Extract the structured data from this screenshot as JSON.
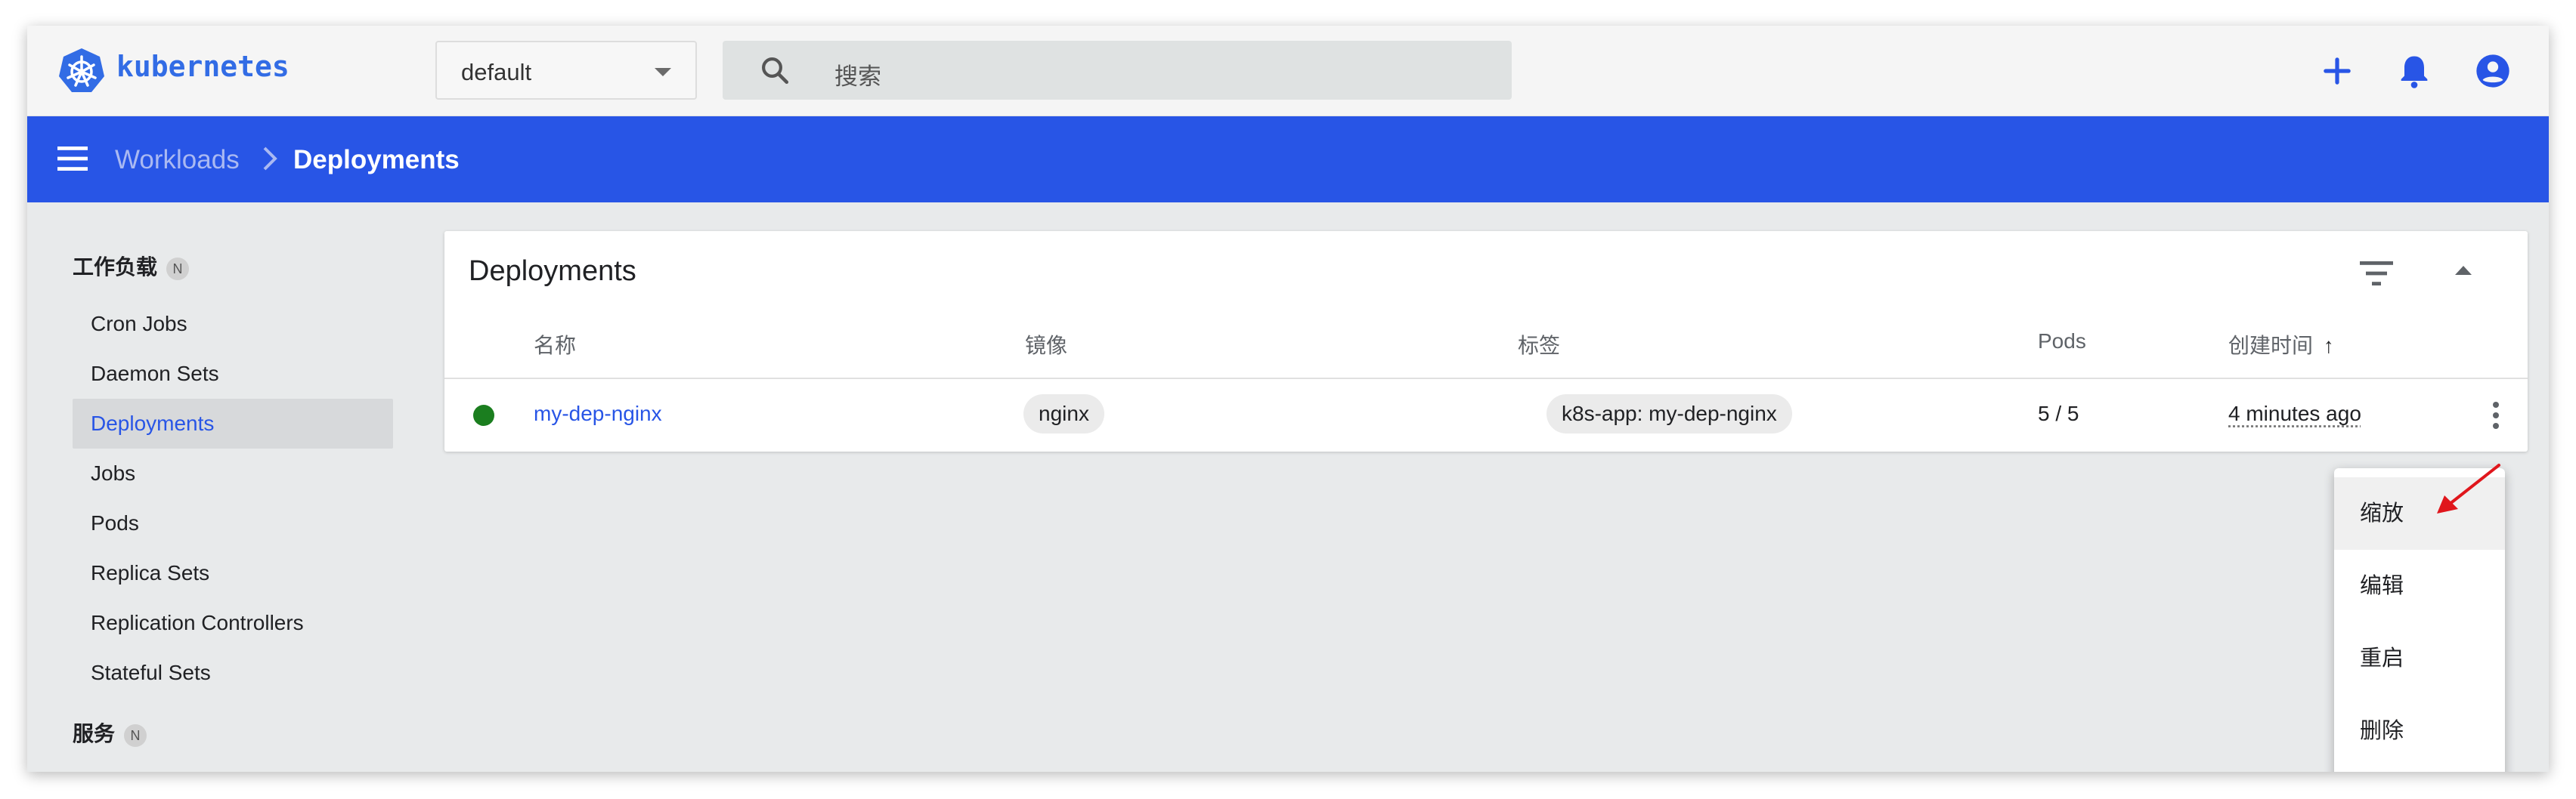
{
  "app": {
    "brand": "kubernetes",
    "accent": "#2855e6",
    "namespace": "default",
    "search_placeholder": "搜索",
    "icons": [
      "kubernetes-logo",
      "search-icon",
      "plus-icon",
      "bell-icon",
      "account-icon"
    ]
  },
  "breadcrumb": {
    "parent": "Workloads",
    "current": "Deployments"
  },
  "sidebar": {
    "section_workloads": "工作负载",
    "section_services": "服务",
    "badge": "N",
    "items": [
      {
        "label": "Cron Jobs"
      },
      {
        "label": "Daemon Sets"
      },
      {
        "label": "Deployments",
        "active": true
      },
      {
        "label": "Jobs"
      },
      {
        "label": "Pods"
      },
      {
        "label": "Replica Sets"
      },
      {
        "label": "Replication Controllers"
      },
      {
        "label": "Stateful Sets"
      }
    ]
  },
  "card": {
    "title": "Deployments",
    "columns": {
      "name": "名称",
      "image": "镜像",
      "labels": "标签",
      "pods": "Pods",
      "created": "创建时间"
    },
    "sort_arrow": "↑",
    "rows": [
      {
        "status_color": "#1b7e1f",
        "name": "my-dep-nginx",
        "image": "nginx",
        "label": "k8s-app: my-dep-nginx",
        "pods": "5 / 5",
        "created": "4 minutes ago"
      }
    ]
  },
  "action_menu": {
    "items": [
      {
        "label": "缩放",
        "highlighted": true
      },
      {
        "label": "编辑"
      },
      {
        "label": "重启"
      },
      {
        "label": "删除"
      }
    ],
    "annotation_color": "#e0161c"
  }
}
